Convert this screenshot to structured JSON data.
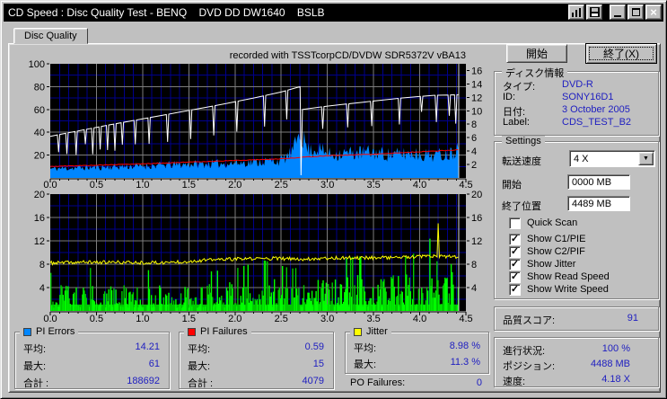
{
  "window": {
    "title": "CD Speed : Disc Quality Test - BENQ    DVD DD DW1640    BSLB"
  },
  "icons": {
    "close": "×",
    "dropdown": "▼",
    "check": "✓"
  },
  "tab": {
    "label": "Disc Quality"
  },
  "buttons": {
    "start": "開始",
    "exit": "終了(X)"
  },
  "disc_info": {
    "legend": "ディスク情報",
    "rows": [
      {
        "label": "タイプ:",
        "value": "DVD-R"
      },
      {
        "label": "ID:",
        "value": "SONY16D1"
      },
      {
        "label": "日付:",
        "value": "3 October 2005"
      },
      {
        "label": "Label:",
        "value": "CDS_TEST_B2"
      }
    ]
  },
  "settings": {
    "legend": "Settings",
    "speed_label": "転送速度",
    "speed_value": "4 X",
    "start_label": "開始",
    "start_value": "0000 MB",
    "end_label": "終了位置",
    "end_value": "4489 MB",
    "checkboxes": [
      {
        "label": "Quick Scan",
        "checked": false
      },
      {
        "label": "Show C1/PIE",
        "checked": true
      },
      {
        "label": "Show C2/PIF",
        "checked": true
      },
      {
        "label": "Show Jitter",
        "checked": true
      },
      {
        "label": "Show Read Speed",
        "checked": true
      },
      {
        "label": "Show Write Speed",
        "checked": true
      }
    ]
  },
  "quality_score": {
    "label": "品質スコア:",
    "value": "91"
  },
  "progress": {
    "rows": [
      {
        "label": "進行状況:",
        "value": "100 %"
      },
      {
        "label": "ポジション:",
        "value": "4488 MB"
      },
      {
        "label": "速度:",
        "value": "4.18 X"
      }
    ]
  },
  "stats_boxes": [
    {
      "legend": "PI Errors",
      "color": "#0086ff",
      "rows": [
        [
          "平均:",
          "14.21"
        ],
        [
          "最大:",
          "61"
        ],
        [
          "合計 :",
          "188692"
        ]
      ]
    },
    {
      "legend": "PI Failures",
      "color": "#ff0000",
      "rows": [
        [
          "平均:",
          "0.59"
        ],
        [
          "最大:",
          "15"
        ],
        [
          "合計 :",
          "4079"
        ]
      ]
    },
    {
      "legend": "Jitter",
      "color": "#ffff00",
      "rows": [
        [
          "平均:",
          "8.98 %"
        ],
        [
          "最大:",
          "11.3 %"
        ]
      ]
    }
  ],
  "po_failures": {
    "label": "PO Failures:",
    "value": "0"
  },
  "chart_data": [
    {
      "name": "pi_errors_and_speed",
      "type": "area",
      "title": "recorded with TSSTcorpCD/DVDW SDR5372V vBA13",
      "x_range": [
        0,
        4.5
      ],
      "x_ticks": [
        "0.0",
        "0.5",
        "1.0",
        "1.5",
        "2.0",
        "2.5",
        "3.0",
        "3.5",
        "4.0",
        "4.5"
      ],
      "left_axis": {
        "range": [
          0,
          100
        ],
        "ticks": [
          100,
          80,
          60,
          40,
          20
        ]
      },
      "right_axis": {
        "range": [
          0,
          17
        ],
        "ticks": [
          16,
          14,
          12,
          10,
          8,
          6,
          4,
          2
        ]
      },
      "grid": {
        "h_major": [
          20,
          40,
          60,
          80
        ],
        "h_minor": [
          10,
          30,
          50,
          70,
          90
        ],
        "v_major": 0.5,
        "v_minor": 0.1
      },
      "data_end_x": 4.42,
      "series": [
        {
          "name": "PI Errors",
          "kind": "noisy_area",
          "axis": "left",
          "color": "#0086ff",
          "seed": 11,
          "step": 0.012,
          "avg": 14.21,
          "max": 61,
          "total": 188692,
          "envelope": [
            [
              0,
              10
            ],
            [
              0.3,
              11
            ],
            [
              0.6,
              12
            ],
            [
              1.0,
              13
            ],
            [
              1.5,
              15
            ],
            [
              2.0,
              16
            ],
            [
              2.3,
              18
            ],
            [
              2.5,
              19
            ],
            [
              2.6,
              26
            ],
            [
              2.65,
              34
            ],
            [
              2.7,
              56
            ],
            [
              2.74,
              42
            ],
            [
              2.8,
              30
            ],
            [
              2.9,
              32
            ],
            [
              3.0,
              26
            ],
            [
              3.2,
              27
            ],
            [
              3.5,
              28
            ],
            [
              3.7,
              25
            ],
            [
              3.9,
              27
            ],
            [
              4.1,
              25
            ],
            [
              4.3,
              26
            ],
            [
              4.38,
              30
            ],
            [
              4.42,
              34
            ]
          ]
        },
        {
          "name": "Read Speed",
          "kind": "noisy_line",
          "axis": "right",
          "color": "#ff0000",
          "seed": 5,
          "step": 0.02,
          "noise": 0.05,
          "end_value_x": 4.18,
          "envelope": [
            [
              0,
              1.7
            ],
            [
              0.5,
              1.9
            ],
            [
              1.0,
              2.1
            ],
            [
              1.5,
              2.35
            ],
            [
              2.0,
              2.6
            ],
            [
              2.5,
              2.85
            ],
            [
              2.75,
              3.1
            ],
            [
              3.0,
              3.3
            ],
            [
              3.5,
              3.55
            ],
            [
              4.0,
              3.9
            ],
            [
              4.42,
              4.18
            ]
          ]
        },
        {
          "name": "Write Speed",
          "kind": "teeth_line",
          "axis": "right",
          "color": "#ffffff",
          "baseline": [
            [
              0,
              6.2
            ],
            [
              0.3,
              7.0
            ],
            [
              0.6,
              7.8
            ],
            [
              1.0,
              8.8
            ],
            [
              1.4,
              9.8
            ],
            [
              1.8,
              10.8
            ],
            [
              2.2,
              11.9
            ],
            [
              2.5,
              12.8
            ],
            [
              2.68,
              13.5
            ],
            [
              2.705,
              13.6
            ],
            [
              2.715,
              0.4
            ],
            [
              2.73,
              10.2
            ],
            [
              3.0,
              10.7
            ],
            [
              3.4,
              11.3
            ],
            [
              3.8,
              11.9
            ],
            [
              4.15,
              12.3
            ],
            [
              4.42,
              12.4
            ]
          ],
          "teeth": [
            [
              0.09,
              2.6
            ],
            [
              0.18,
              3.1
            ],
            [
              0.28,
              3.5
            ],
            [
              0.38,
              2.2
            ],
            [
              0.46,
              3.9
            ],
            [
              0.54,
              3.4
            ],
            [
              0.62,
              3.7
            ],
            [
              0.7,
              4.0
            ],
            [
              0.78,
              3.3
            ],
            [
              0.92,
              3.6
            ],
            [
              1.07,
              3.9
            ],
            [
              1.27,
              4.1
            ],
            [
              1.52,
              4.3
            ],
            [
              1.77,
              4.4
            ],
            [
              2.02,
              4.5
            ],
            [
              2.32,
              4.6
            ],
            [
              2.56,
              4.3
            ],
            [
              2.95,
              3.3
            ],
            [
              3.22,
              3.5
            ],
            [
              3.48,
              3.7
            ],
            [
              3.78,
              3.9
            ],
            [
              4.02,
              2.3
            ],
            [
              4.18,
              4.0
            ],
            [
              4.32,
              3.1
            ],
            [
              4.39,
              4.3
            ]
          ]
        }
      ]
    },
    {
      "name": "pi_failures_and_jitter",
      "type": "bar",
      "x_range": [
        0,
        4.5
      ],
      "x_ticks": [
        "0.0",
        "0.5",
        "1.0",
        "1.5",
        "2.0",
        "2.5",
        "3.0",
        "3.5",
        "4.0",
        "4.5"
      ],
      "left_axis": {
        "range": [
          0,
          20
        ],
        "ticks": [
          20,
          16,
          12,
          8,
          4
        ]
      },
      "right_axis": {
        "range": [
          0,
          20
        ],
        "ticks": [
          20,
          16,
          12,
          8,
          4
        ]
      },
      "grid": {
        "h_major": [
          4,
          8,
          12,
          16
        ],
        "h_minor": [
          2,
          6,
          10,
          14,
          18
        ],
        "v_major": 0.5,
        "v_minor": 0.1
      },
      "data_end_x": 4.42,
      "series": [
        {
          "name": "PI Failures",
          "kind": "noisy_bars",
          "axis": "left",
          "colors": [
            "#00ff00",
            "#00c800"
          ],
          "seed": 23,
          "step": 0.011,
          "base_height": 1.1,
          "avg": 0.59,
          "max": 15,
          "total": 4079,
          "envelope": [
            [
              0,
              4.5
            ],
            [
              0.3,
              5.5
            ],
            [
              0.6,
              4.5
            ],
            [
              1.0,
              5.0
            ],
            [
              1.3,
              4.0
            ],
            [
              1.6,
              4.5
            ],
            [
              2.0,
              5.0
            ],
            [
              2.3,
              6.0
            ],
            [
              2.6,
              5.0
            ],
            [
              3.0,
              5.5
            ],
            [
              3.3,
              6.5
            ],
            [
              3.6,
              6.0
            ],
            [
              3.9,
              6.5
            ],
            [
              4.05,
              8.0
            ],
            [
              4.2,
              9.5
            ],
            [
              4.35,
              8.0
            ],
            [
              4.42,
              7.0
            ]
          ]
        },
        {
          "name": "Jitter",
          "kind": "noisy_line",
          "axis": "left",
          "color": "#ffff00",
          "seed": 37,
          "step": 0.012,
          "noise": 0.3,
          "avg_pct": 8.98,
          "max_pct": 11.3,
          "envelope": [
            [
              0,
              8.2
            ],
            [
              0.4,
              8.35
            ],
            [
              0.8,
              8.3
            ],
            [
              1.2,
              8.25
            ],
            [
              1.5,
              8.5
            ],
            [
              1.8,
              8.8
            ],
            [
              2.1,
              8.9
            ],
            [
              2.4,
              9.0
            ],
            [
              2.7,
              8.85
            ],
            [
              3.0,
              9.05
            ],
            [
              3.3,
              9.1
            ],
            [
              3.6,
              9.15
            ],
            [
              3.9,
              9.2
            ],
            [
              4.1,
              9.35
            ],
            [
              4.25,
              9.3
            ],
            [
              4.42,
              9.2
            ]
          ],
          "spikes": [
            [
              4.2,
              15.0
            ]
          ]
        }
      ]
    }
  ]
}
